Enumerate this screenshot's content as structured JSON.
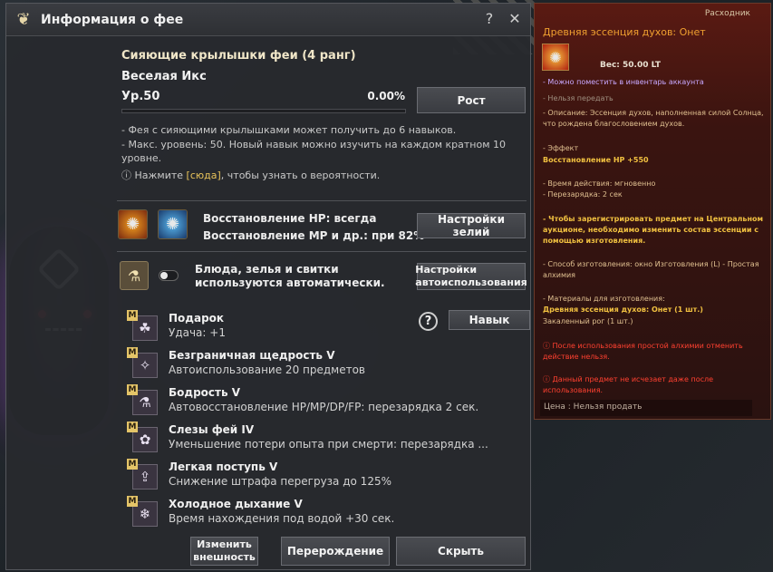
{
  "window": {
    "title": "Информация о фее",
    "help_btn": "?",
    "close_btn": "✕"
  },
  "fairy": {
    "name": "Сияющие крылышки феи (4 ранг)",
    "player": "Веселая Икс",
    "level": "Ур.50",
    "percent": "0.00%",
    "progress": 0.0,
    "growth_label": "Рост"
  },
  "info": {
    "line1": "- Фея с сияющими крылышками может получить до 6 навыков.",
    "line2": "- Макс. уровень: 50. Новый навык можно изучить на каждом кратном 10 уровне.",
    "line3_icon": "ⓘ",
    "line3_prefix": " Нажмите ",
    "line3_link": "[сюда]",
    "line3_suffix": ", чтобы узнать о вероятности."
  },
  "potions": {
    "hp_text": "Восстановление HP: всегда",
    "mp_text": "Восстановление MP и др.: при 82%",
    "settings_label": "Настройки зелий"
  },
  "auto_use": {
    "text": "Блюда, зелья и свитки используются автоматически.",
    "settings_label": "Настройки автоиспользования",
    "enabled": false
  },
  "skill_controls": {
    "help": "?",
    "skill_label": "Навык"
  },
  "skills": [
    {
      "badge": "M",
      "icon": "clover-icon",
      "glyph": "☘",
      "name": "Подарок",
      "desc": "Удача: +1"
    },
    {
      "badge": "M",
      "icon": "fairy-icon",
      "glyph": "✧",
      "name": "Безграничная щедрость V",
      "desc": "Автоиспользование 20 предметов"
    },
    {
      "badge": "M",
      "icon": "potion-icon",
      "glyph": "⚗",
      "name": "Бодрость V",
      "desc": "Автовосстановление HP/MP/DP/FP: перезарядка 2 сек."
    },
    {
      "badge": "M",
      "icon": "tears-icon",
      "glyph": "✿",
      "name": "Слезы фей IV",
      "desc": "Уменьшение потери опыта при смерти: перезарядка ..."
    },
    {
      "badge": "M",
      "icon": "weight-icon",
      "glyph": "⇪",
      "name": "Легкая поступь V",
      "desc": "Снижение штрафа перегруза до 125%"
    },
    {
      "badge": "M",
      "icon": "breath-icon",
      "glyph": "❄",
      "name": "Холодное дыхание V",
      "desc": "Время нахождения под водой +30 сек."
    }
  ],
  "footer": {
    "change_look": "Изменить внешность",
    "rebirth": "Перерождение",
    "hide": "Скрыть"
  },
  "tooltip": {
    "category": "Расходник",
    "title": "Древняя эссенция духов: Онет",
    "weight": "Вес:    50.00 LT",
    "l1": "- Можно поместить в инвентарь аккаунта",
    "l2": "- Нельзя передать",
    "l3": "- Описание: Эссенция духов, наполненная силой Солнца, что рождена благословением духов.",
    "l4": "- Эффект",
    "l5": "Восстановление HP +550",
    "l6": "- Время действия: мгновенно",
    "l7": "- Перезарядка: 2 сек",
    "l8": "- Чтобы зарегистрировать предмет на Центральном аукционе, необходимо изменить состав эссенции с помощью изготовления.",
    "l9": "- Способ изготовления: окно Изготовления (L) - Простая алхимия",
    "l10": "- Материалы для изготовления:",
    "l11": "Древняя эссенция духов: Онет (1 шт.)",
    "l12": "Закаленный рог (1 шт.)",
    "l13": "ⓘ После использования простой алхимии отменить действие нельзя.",
    "l14": "ⓘ Данный предмет не исчезает даже после использования.",
    "price": "Цена :   Нельзя продать"
  }
}
